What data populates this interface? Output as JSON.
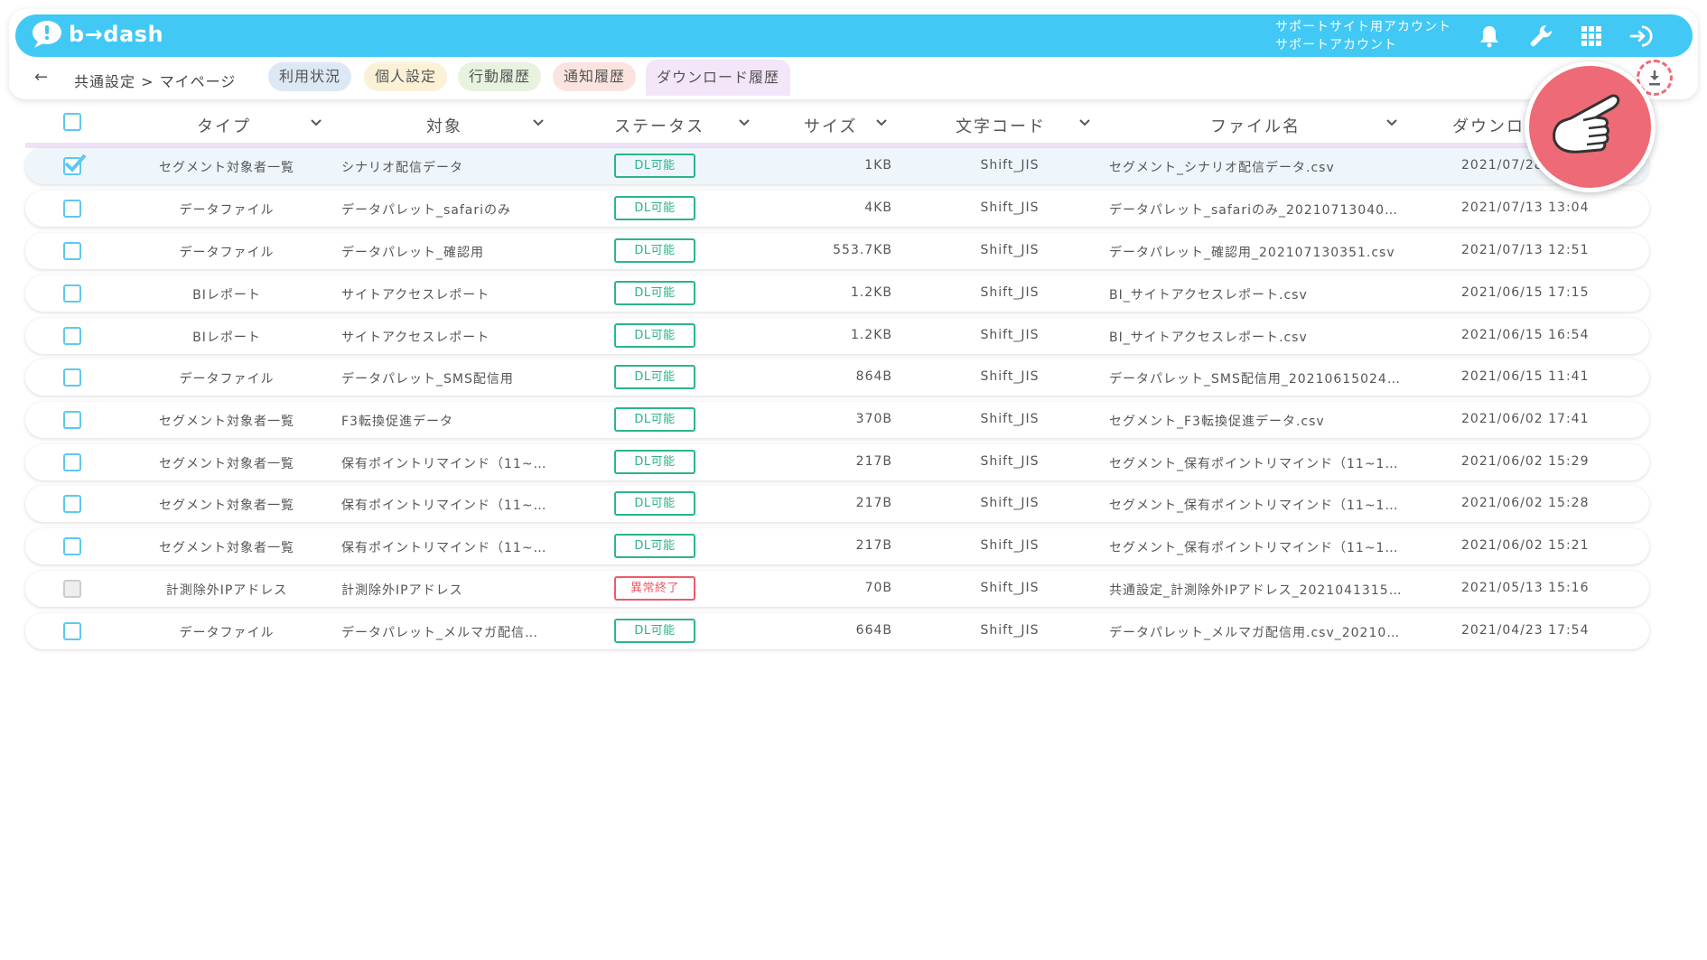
{
  "app": {
    "logo_text": "b→dash"
  },
  "header": {
    "account_line1": "サポートサイト用アカウント",
    "account_line2": "サポートアカウント"
  },
  "breadcrumb": {
    "back_glyph": "←",
    "path": "共通設定 > マイページ"
  },
  "tabs": [
    {
      "label": "利用状況",
      "color": "#dce8f3"
    },
    {
      "label": "個人設定",
      "color": "#fbf1d6"
    },
    {
      "label": "行動履歴",
      "color": "#e7f2df"
    },
    {
      "label": "通知履歴",
      "color": "#fbe4df"
    },
    {
      "label": "ダウンロード履歴",
      "color": "#f3e6f8",
      "active": true
    }
  ],
  "columns": {
    "type": "タイプ",
    "target": "対象",
    "status": "ステータス",
    "size": "サイズ",
    "encoding": "文字コード",
    "filename": "ファイル名",
    "download": "ダウンロ"
  },
  "rows": [
    {
      "checked": true,
      "type": "セグメント対象者一覧",
      "target": "シナリオ配信データ",
      "status": "DL可能",
      "size": "1KB",
      "encoding": "Shift_JIS",
      "filename": "セグメント_シナリオ配信データ.csv",
      "date": "2021/07/28"
    },
    {
      "checked": false,
      "type": "データファイル",
      "target": "データパレット_safariのみ",
      "status": "DL可能",
      "size": "4KB",
      "encoding": "Shift_JIS",
      "filename": "データパレット_safariのみ_20210713040…",
      "date": "2021/07/13 13:04"
    },
    {
      "checked": false,
      "type": "データファイル",
      "target": "データパレット_確認用",
      "status": "DL可能",
      "size": "553.7KB",
      "encoding": "Shift_JIS",
      "filename": "データパレット_確認用_202107130351.csv",
      "date": "2021/07/13 12:51"
    },
    {
      "checked": false,
      "type": "BIレポート",
      "target": "サイトアクセスレポート",
      "status": "DL可能",
      "size": "1.2KB",
      "encoding": "Shift_JIS",
      "filename": "BI_サイトアクセスレポート.csv",
      "date": "2021/06/15 17:15"
    },
    {
      "checked": false,
      "type": "BIレポート",
      "target": "サイトアクセスレポート",
      "status": "DL可能",
      "size": "1.2KB",
      "encoding": "Shift_JIS",
      "filename": "BI_サイトアクセスレポート.csv",
      "date": "2021/06/15 16:54"
    },
    {
      "checked": false,
      "type": "データファイル",
      "target": "データパレット_SMS配信用",
      "status": "DL可能",
      "size": "864B",
      "encoding": "Shift_JIS",
      "filename": "データパレット_SMS配信用_20210615024…",
      "date": "2021/06/15 11:41"
    },
    {
      "checked": false,
      "type": "セグメント対象者一覧",
      "target": "F3転換促進データ",
      "status": "DL可能",
      "size": "370B",
      "encoding": "Shift_JIS",
      "filename": "セグメント_F3転換促進データ.csv",
      "date": "2021/06/02 17:41"
    },
    {
      "checked": false,
      "type": "セグメント対象者一覧",
      "target": "保有ポイントリマインド（11~…",
      "status": "DL可能",
      "size": "217B",
      "encoding": "Shift_JIS",
      "filename": "セグメント_保有ポイントリマインド（11~1…",
      "date": "2021/06/02 15:29"
    },
    {
      "checked": false,
      "type": "セグメント対象者一覧",
      "target": "保有ポイントリマインド（11~…",
      "status": "DL可能",
      "size": "217B",
      "encoding": "Shift_JIS",
      "filename": "セグメント_保有ポイントリマインド（11~1…",
      "date": "2021/06/02 15:28"
    },
    {
      "checked": false,
      "type": "セグメント対象者一覧",
      "target": "保有ポイントリマインド（11~…",
      "status": "DL可能",
      "size": "217B",
      "encoding": "Shift_JIS",
      "filename": "セグメント_保有ポイントリマインド（11~1…",
      "date": "2021/06/02 15:21"
    },
    {
      "checked": false,
      "disabled": true,
      "type": "計測除外IPアドレス",
      "target": "計測除外IPアドレス",
      "status": "異常終了",
      "error": true,
      "size": "70B",
      "encoding": "Shift_JIS",
      "filename": "共通設定_計測除外IPアドレス_2021041315…",
      "date": "2021/05/13 15:16"
    },
    {
      "checked": false,
      "type": "データファイル",
      "target": "データパレット_メルマガ配信…",
      "status": "DL可能",
      "size": "664B",
      "encoding": "Shift_JIS",
      "filename": "データパレット_メルマガ配信用.csv_20210…",
      "date": "2021/04/23 17:54"
    }
  ],
  "colors": {
    "header_bg": "#41c8f5",
    "ok_green": "#2bb58a",
    "error_red": "#ee5a68",
    "checkbox_blue": "#5ec8ef",
    "pointer_red": "#ee6a76"
  },
  "icons": [
    "bell-icon",
    "wrench-icon",
    "grid-icon",
    "logout-icon",
    "download-icon",
    "hand-pointer-icon"
  ]
}
